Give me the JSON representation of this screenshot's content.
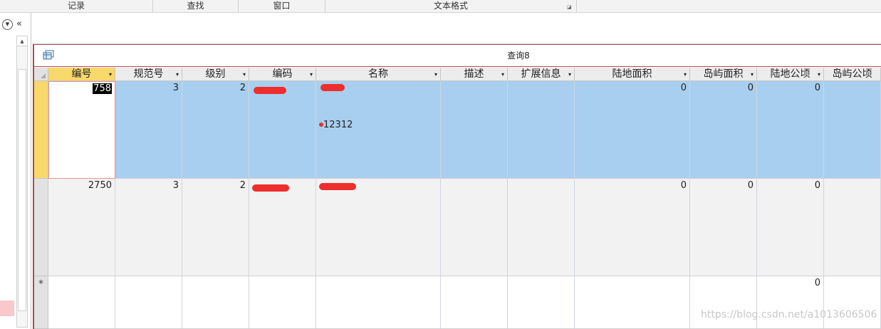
{
  "ribbon": {
    "groups": [
      "记录",
      "查找",
      "窗口",
      "文本格式"
    ]
  },
  "nav": {
    "dropdown_icon": "circle-chevron-down-icon",
    "collapse_label": "«"
  },
  "document": {
    "title": "查询8",
    "icon": "query-datasheet-icon"
  },
  "grid": {
    "columns": [
      "编号",
      "规范号",
      "级别",
      "编码",
      "名称",
      "描述",
      "扩展信息",
      "陆地面积",
      "岛屿面积",
      "陆地公顷",
      "岛屿公顷"
    ],
    "rows": [
      {
        "state": "selected",
        "cells": [
          "758",
          "3",
          "2",
          "",
          "",
          "",
          "",
          "0",
          "0",
          "0",
          ""
        ],
        "name_second_line": "12312"
      },
      {
        "state": "normal",
        "cells": [
          "2750",
          "3",
          "2",
          "",
          "",
          "",
          "",
          "0",
          "0",
          "0",
          ""
        ]
      }
    ],
    "new_row": {
      "marker": "*",
      "cells": [
        "",
        "",
        "",
        "",
        "",
        "",
        "",
        "",
        "",
        "0",
        ""
      ]
    }
  },
  "watermark": "https://blog.csdn.net/a1013606506"
}
